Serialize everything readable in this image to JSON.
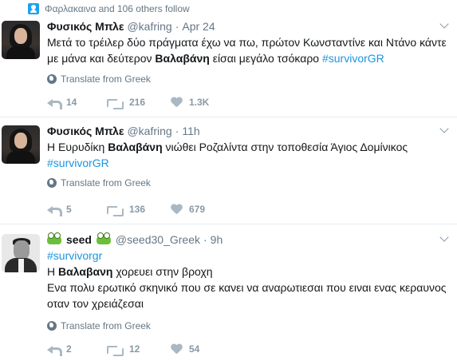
{
  "context": {
    "icon": "person-follow-icon",
    "text": "Φαρλακαινα and 106 others follow"
  },
  "tweets": [
    {
      "fullname": "Φυσικός Μπλε",
      "username": "@kafring",
      "separator": "·",
      "time": "Apr 24",
      "text_parts": [
        "Μετά το τρέιλερ δύο πράγματα έχω να πω, πρώτον Κωνσταντίνε και Ντάνο κάντε με μάνα και δεύτερον ",
        "Βαλαβάνη",
        " είσαι μεγάλο τσόκαρο ",
        "#survivorGR"
      ],
      "translate": "Translate from Greek",
      "replies": "14",
      "retweets": "216",
      "likes": "1.3K"
    },
    {
      "fullname": "Φυσικός Μπλε",
      "username": "@kafring",
      "separator": "·",
      "time": "11h",
      "text_parts": [
        "Η Ευρυδίκη ",
        "Βαλαβάνη",
        " νιώθει Ροζαλίντα στην τοποθεσία Άγιος Δομίνικος",
        "#survivorGR"
      ],
      "translate": "Translate from Greek",
      "replies": "5",
      "retweets": "136",
      "likes": "679"
    },
    {
      "fullname": "seed",
      "username": "@seed30_Greek",
      "separator": "·",
      "time": "9h",
      "hashtag_line": "#survivorgr",
      "text_parts": [
        "Η ",
        "Βαλαβανη",
        " χορευει στην βροχη",
        "Ενα πολυ ερωτικό σκηνικό που σε κανει να αναρωτιεσαι που ειναι ενας κεραυνος",
        "οταν τον χρειάζεσαι"
      ],
      "translate": "Translate from Greek",
      "replies": "2",
      "retweets": "12",
      "likes": "54"
    }
  ],
  "icons": {
    "reply": "reply-icon",
    "retweet": "retweet-icon",
    "like": "heart-icon",
    "translate": "globe-icon",
    "more": "chevron-down-icon"
  },
  "colors": {
    "link": "#1b95e0",
    "muted": "#657786",
    "action": "#aab8c2"
  }
}
